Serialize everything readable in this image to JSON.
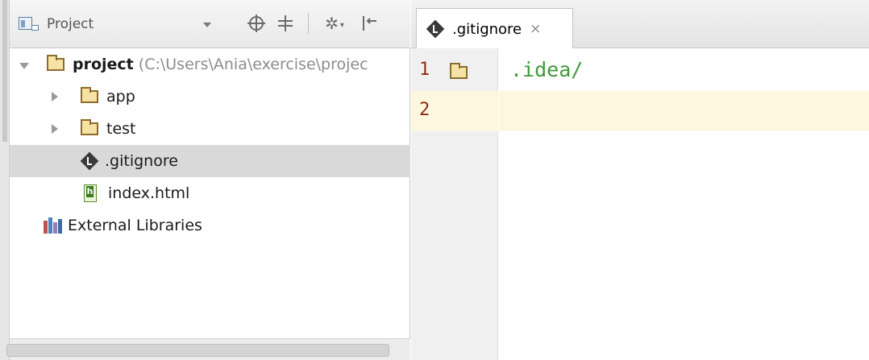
{
  "project_panel": {
    "view_selector": {
      "label": "Project"
    },
    "toolbar": {
      "locate_icon": "crosshair-icon",
      "collapse_icon": "collapse-all-icon",
      "settings_icon": "gear-icon",
      "hide_icon": "hide-panel-icon"
    },
    "tree": [
      {
        "label": "project",
        "path": "(C:\\Users\\Ania\\exercise\\projec",
        "type": "folder",
        "expanded": true,
        "depth": 0,
        "selected": false
      },
      {
        "label": "app",
        "type": "folder",
        "expanded": false,
        "depth": 1,
        "selected": false
      },
      {
        "label": "test",
        "type": "folder",
        "expanded": false,
        "depth": 1,
        "selected": false
      },
      {
        "label": ".gitignore",
        "type": "git-file",
        "depth": 1,
        "selected": true
      },
      {
        "label": "index.html",
        "type": "html-file",
        "depth": 1,
        "selected": false
      },
      {
        "label": "External Libraries",
        "type": "libraries",
        "depth": 0,
        "selected": false
      }
    ]
  },
  "editor": {
    "tabs": [
      {
        "label": ".gitignore",
        "active": true,
        "close": "×"
      }
    ],
    "lines": [
      {
        "number": "1",
        "text": ".idea/"
      },
      {
        "number": "2",
        "text": ""
      }
    ],
    "colors": {
      "caret_line": "#fdf7df",
      "line_number": "#8c2b1b",
      "code_text": "#3f9a3a",
      "selection": "#d9d9d9"
    }
  }
}
